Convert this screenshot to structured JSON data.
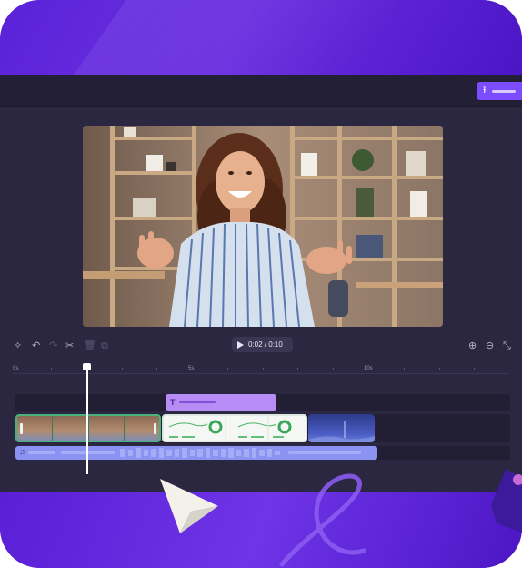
{
  "colors": {
    "accent": "#7b4dff",
    "background_purple": "#5b1fd8",
    "editor_panel": "#2b2740",
    "text_track": "#b78df5",
    "audio_track": "#8a92f2"
  },
  "header": {
    "export_icon": "upload-icon"
  },
  "toolbar": {
    "icons": [
      "magic-wand-icon",
      "undo-icon",
      "redo-icon",
      "scissors-icon",
      "trash-icon",
      "duplicate-icon"
    ],
    "playback": {
      "time_display": "0:02 / 0:10"
    },
    "zoom_icons": [
      "zoom-in-icon",
      "zoom-out-icon",
      "fit-icon"
    ]
  },
  "timeline": {
    "ruler_labels": [
      "0s",
      "5s",
      "10s"
    ],
    "playhead_seconds": 2,
    "tracks": {
      "text": {
        "icon": "text-icon",
        "glyph": "T"
      },
      "video": {
        "clips": [
          "video-clip-woman",
          "video-clip-chart",
          "video-clip-blue"
        ]
      },
      "audio": {
        "icon": "music-note-icon",
        "glyph": "♫"
      }
    }
  }
}
